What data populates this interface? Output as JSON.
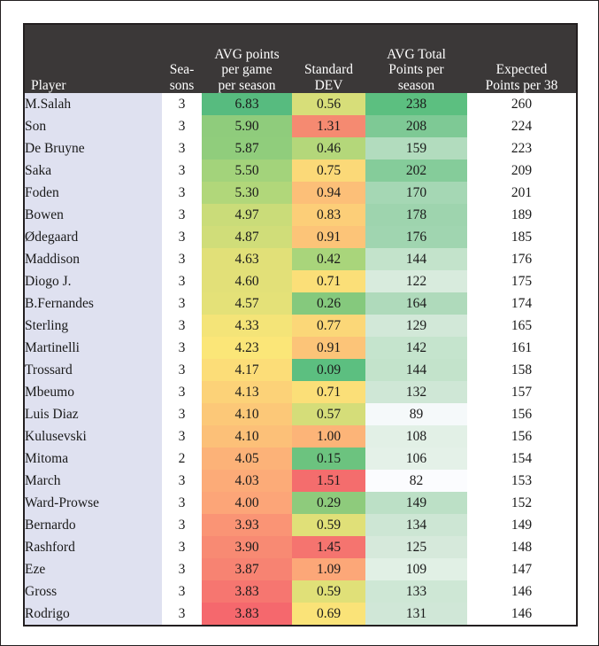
{
  "table": {
    "headers": [
      {
        "id": "player",
        "lines": [
          "Player"
        ]
      },
      {
        "id": "seasons",
        "lines": [
          "Sea-",
          "sons"
        ]
      },
      {
        "id": "avg_ppg",
        "lines": [
          "AVG points",
          "per game",
          "per season"
        ]
      },
      {
        "id": "std_dev",
        "lines": [
          "Standard",
          "DEV"
        ]
      },
      {
        "id": "avg_tot",
        "lines": [
          "AVG Total",
          "Points per",
          "season"
        ]
      },
      {
        "id": "expected",
        "lines": [
          "Expected",
          "Points per 38"
        ]
      }
    ],
    "colors": {
      "header_bg": "#3b3838",
      "header_fg": "#ffffff",
      "player_bg": "#dfe1f0",
      "border": "#231f20",
      "page_bg": "#ffffff"
    },
    "rows": [
      {
        "player": "M.Salah",
        "seasons": "3",
        "avg_ppg": "6.83",
        "avg_ppg_bg": "#57bb7f",
        "std_dev": "0.56",
        "std_dev_bg": "#d7de79",
        "avg_tot": "238",
        "avg_tot_bg": "#5cbf80",
        "expected": "260"
      },
      {
        "player": "Son",
        "seasons": "3",
        "avg_ppg": "5.90",
        "avg_ppg_bg": "#8fcc7c",
        "std_dev": "1.31",
        "std_dev_bg": "#f58a71",
        "avg_tot": "208",
        "avg_tot_bg": "#7ec995",
        "expected": "224"
      },
      {
        "player": "De Bruyne",
        "seasons": "3",
        "avg_ppg": "5.87",
        "avg_ppg_bg": "#90cd7c",
        "std_dev": "0.46",
        "std_dev_bg": "#b4d77a",
        "avg_tot": "159",
        "avg_tot_bg": "#b2dcbe",
        "expected": "223"
      },
      {
        "player": "Saka",
        "seasons": "3",
        "avg_ppg": "5.50",
        "avg_ppg_bg": "#a3d37b",
        "std_dev": "0.75",
        "std_dev_bg": "#fbd978",
        "avg_tot": "202",
        "avg_tot_bg": "#85cc9a",
        "expected": "209"
      },
      {
        "player": "Foden",
        "seasons": "3",
        "avg_ppg": "5.30",
        "avg_ppg_bg": "#b1d77a",
        "std_dev": "0.94",
        "std_dev_bg": "#fcbf78",
        "avg_tot": "170",
        "avg_tot_bg": "#a5d7b4",
        "expected": "201"
      },
      {
        "player": "Bowen",
        "seasons": "3",
        "avg_ppg": "4.97",
        "avg_ppg_bg": "#cadc79",
        "std_dev": "0.83",
        "std_dev_bg": "#fcce78",
        "avg_tot": "178",
        "avg_tot_bg": "#9ed4ae",
        "expected": "189"
      },
      {
        "player": "Ødegaard",
        "seasons": "3",
        "avg_ppg": "4.87",
        "avg_ppg_bg": "#d0dd79",
        "std_dev": "0.91",
        "std_dev_bg": "#fcc478",
        "avg_tot": "176",
        "avg_tot_bg": "#a0d5b0",
        "expected": "185"
      },
      {
        "player": "Maddison",
        "seasons": "3",
        "avg_ppg": "4.63",
        "avg_ppg_bg": "#e1e078",
        "std_dev": "0.42",
        "std_dev_bg": "#a9d57b",
        "avg_tot": "144",
        "avg_tot_bg": "#c3e3cb",
        "expected": "176"
      },
      {
        "player": "Diogo J.",
        "seasons": "3",
        "avg_ppg": "4.60",
        "avg_ppg_bg": "#e2e078",
        "std_dev": "0.71",
        "std_dev_bg": "#fbdf78",
        "avg_tot": "122",
        "avg_tot_bg": "#d8ebdd",
        "expected": "175"
      },
      {
        "player": "B.Fernandes",
        "seasons": "3",
        "avg_ppg": "4.57",
        "avg_ppg_bg": "#e4e178",
        "std_dev": "0.26",
        "std_dev_bg": "#85c97d",
        "avg_tot": "164",
        "avg_tot_bg": "#afdabb",
        "expected": "174"
      },
      {
        "player": "Sterling",
        "seasons": "3",
        "avg_ppg": "4.33",
        "avg_ppg_bg": "#f4e478",
        "std_dev": "0.77",
        "std_dev_bg": "#fbd778",
        "avg_tot": "129",
        "avg_tot_bg": "#d2e8d8",
        "expected": "165"
      },
      {
        "player": "Martinelli",
        "seasons": "3",
        "avg_ppg": "4.23",
        "avg_ppg_bg": "#fbe678",
        "std_dev": "0.91",
        "std_dev_bg": "#fcc478",
        "avg_tot": "142",
        "avg_tot_bg": "#c5e4cd",
        "expected": "161"
      },
      {
        "player": "Trossard",
        "seasons": "3",
        "avg_ppg": "4.17",
        "avg_ppg_bg": "#fcdd78",
        "std_dev": "0.09",
        "std_dev_bg": "#5cbf80",
        "avg_tot": "144",
        "avg_tot_bg": "#c3e3cb",
        "expected": "158"
      },
      {
        "player": "Mbeumo",
        "seasons": "3",
        "avg_ppg": "4.13",
        "avg_ppg_bg": "#fcd278",
        "std_dev": "0.71",
        "std_dev_bg": "#fbdf78",
        "avg_tot": "132",
        "avg_tot_bg": "#cfe7d6",
        "expected": "157"
      },
      {
        "player": "Luis Diaz",
        "seasons": "3",
        "avg_ppg": "4.10",
        "avg_ppg_bg": "#fcc878",
        "std_dev": "0.57",
        "std_dev_bg": "#d5dd79",
        "avg_tot": "89",
        "avg_tot_bg": "#f5f9fa",
        "expected": "156"
      },
      {
        "player": "Kulusevski",
        "seasons": "3",
        "avg_ppg": "4.10",
        "avg_ppg_bg": "#fcc078",
        "std_dev": "1.00",
        "std_dev_bg": "#fcb478",
        "avg_tot": "108",
        "avg_tot_bg": "#e2f0e6",
        "expected": "156"
      },
      {
        "player": "Mitoma",
        "seasons": "2",
        "avg_ppg": "4.05",
        "avg_ppg_bg": "#fcb278",
        "std_dev": "0.15",
        "std_dev_bg": "#6cc37f",
        "avg_tot": "106",
        "avg_tot_bg": "#e4f1e8",
        "expected": "154"
      },
      {
        "player": "March",
        "seasons": "3",
        "avg_ppg": "4.03",
        "avg_ppg_bg": "#fcab78",
        "std_dev": "1.51",
        "std_dev_bg": "#f46d6d",
        "avg_tot": "82",
        "avg_tot_bg": "#fbfcfe",
        "expected": "153"
      },
      {
        "player": "Ward-Prowse",
        "seasons": "3",
        "avg_ppg": "4.00",
        "avg_ppg_bg": "#fca578",
        "std_dev": "0.29",
        "std_dev_bg": "#8ecb7c",
        "avg_tot": "149",
        "avg_tot_bg": "#bce0c6",
        "expected": "152"
      },
      {
        "player": "Bernardo",
        "seasons": "3",
        "avg_ppg": "3.93",
        "avg_ppg_bg": "#fa9475",
        "std_dev": "0.59",
        "std_dev_bg": "#e0e078",
        "avg_tot": "134",
        "avg_tot_bg": "#cde6d4",
        "expected": "149"
      },
      {
        "player": "Rashford",
        "seasons": "3",
        "avg_ppg": "3.90",
        "avg_ppg_bg": "#f88a73",
        "std_dev": "1.45",
        "std_dev_bg": "#f5746f",
        "avg_tot": "125",
        "avg_tot_bg": "#d6e9db",
        "expected": "148"
      },
      {
        "player": "Eze",
        "seasons": "3",
        "avg_ppg": "3.87",
        "avg_ppg_bg": "#f78372",
        "std_dev": "1.09",
        "std_dev_bg": "#fca778",
        "avg_tot": "109",
        "avg_tot_bg": "#e1f0e5",
        "expected": "147"
      },
      {
        "player": "Gross",
        "seasons": "3",
        "avg_ppg": "3.83",
        "avg_ppg_bg": "#f67670",
        "std_dev": "0.59",
        "std_dev_bg": "#e0e078",
        "avg_tot": "133",
        "avg_tot_bg": "#cee7d5",
        "expected": "146"
      },
      {
        "player": "Rodrigo",
        "seasons": "3",
        "avg_ppg": "3.83",
        "avg_ppg_bg": "#f5686d",
        "std_dev": "0.69",
        "std_dev_bg": "#fae378",
        "avg_tot": "131",
        "avg_tot_bg": "#d0e7d7",
        "expected": "146"
      }
    ]
  }
}
